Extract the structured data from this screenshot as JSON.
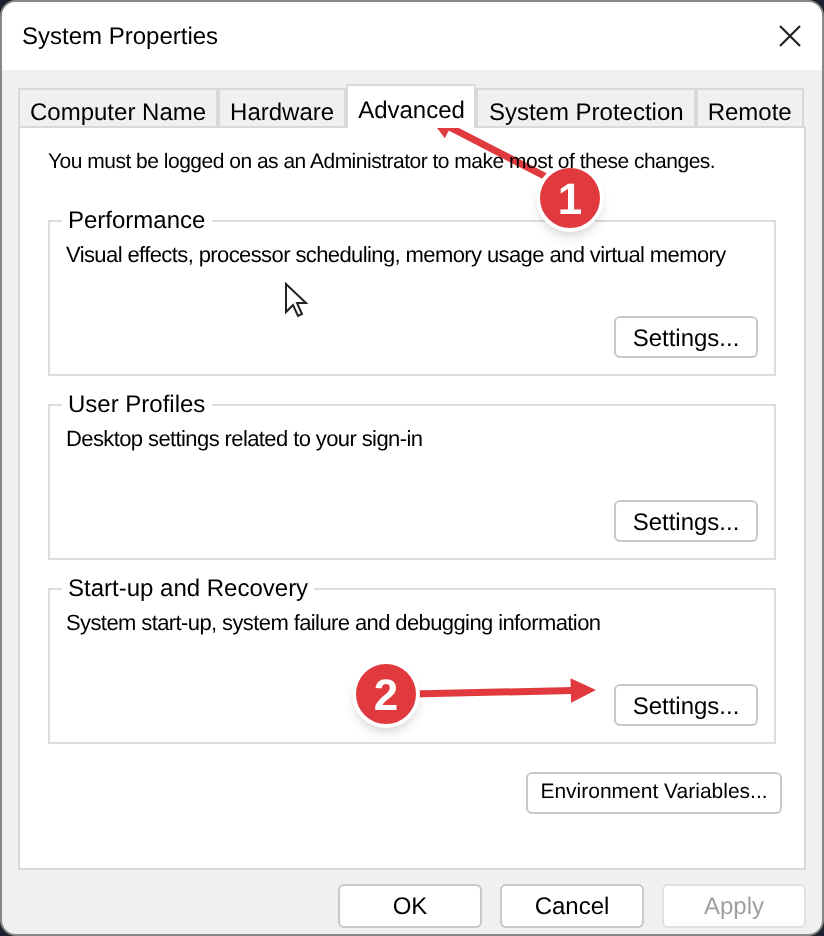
{
  "window": {
    "title": "System Properties"
  },
  "tabs": [
    {
      "label": "Computer Name",
      "selected": false
    },
    {
      "label": "Hardware",
      "selected": false
    },
    {
      "label": "Advanced",
      "selected": true
    },
    {
      "label": "System Protection",
      "selected": false
    },
    {
      "label": "Remote",
      "selected": false
    }
  ],
  "notice": "You must be logged on as an Administrator to make most of these changes.",
  "groups": [
    {
      "title": "Performance",
      "description": "Visual effects, processor scheduling, memory usage and virtual memory",
      "button": "Settings..."
    },
    {
      "title": "User Profiles",
      "description": "Desktop settings related to your sign-in",
      "button": "Settings..."
    },
    {
      "title": "Start-up and Recovery",
      "description": "System start-up, system failure and debugging information",
      "button": "Settings..."
    }
  ],
  "environment_button": "Environment Variables...",
  "footer_buttons": [
    {
      "label": "OK",
      "disabled": false
    },
    {
      "label": "Cancel",
      "disabled": false
    },
    {
      "label": "Apply",
      "disabled": true
    }
  ],
  "annotations": [
    {
      "label": "1"
    },
    {
      "label": "2"
    }
  ]
}
